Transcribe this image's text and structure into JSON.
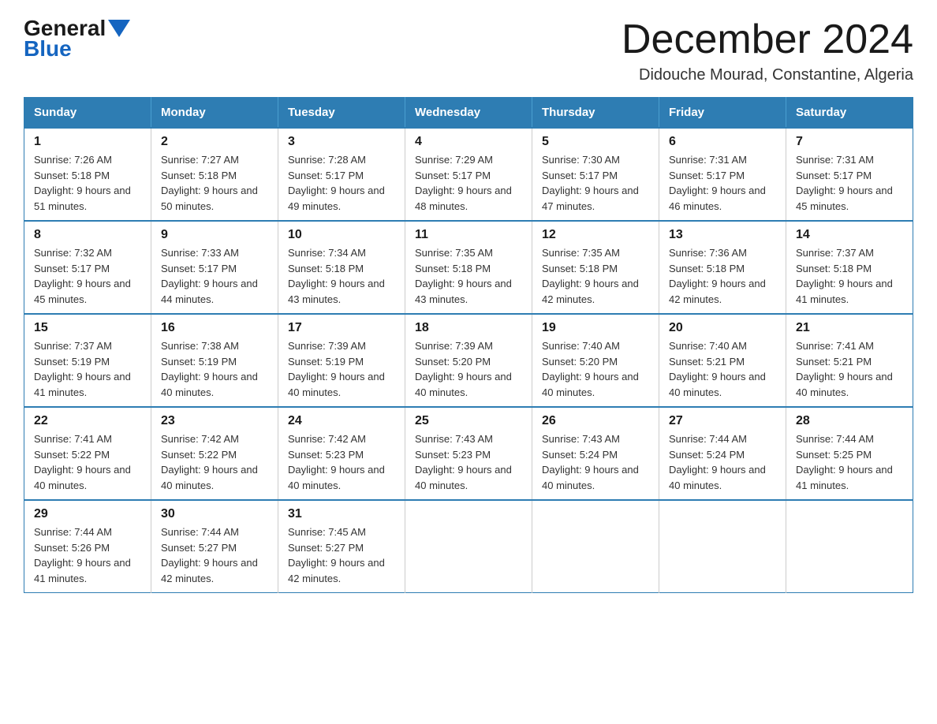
{
  "logo": {
    "general_text": "General",
    "blue_text": "Blue"
  },
  "header": {
    "month_year": "December 2024",
    "location": "Didouche Mourad, Constantine, Algeria"
  },
  "weekdays": [
    "Sunday",
    "Monday",
    "Tuesday",
    "Wednesday",
    "Thursday",
    "Friday",
    "Saturday"
  ],
  "weeks": [
    [
      {
        "day": "1",
        "sunrise": "7:26 AM",
        "sunset": "5:18 PM",
        "daylight": "9 hours and 51 minutes."
      },
      {
        "day": "2",
        "sunrise": "7:27 AM",
        "sunset": "5:18 PM",
        "daylight": "9 hours and 50 minutes."
      },
      {
        "day": "3",
        "sunrise": "7:28 AM",
        "sunset": "5:17 PM",
        "daylight": "9 hours and 49 minutes."
      },
      {
        "day": "4",
        "sunrise": "7:29 AM",
        "sunset": "5:17 PM",
        "daylight": "9 hours and 48 minutes."
      },
      {
        "day": "5",
        "sunrise": "7:30 AM",
        "sunset": "5:17 PM",
        "daylight": "9 hours and 47 minutes."
      },
      {
        "day": "6",
        "sunrise": "7:31 AM",
        "sunset": "5:17 PM",
        "daylight": "9 hours and 46 minutes."
      },
      {
        "day": "7",
        "sunrise": "7:31 AM",
        "sunset": "5:17 PM",
        "daylight": "9 hours and 45 minutes."
      }
    ],
    [
      {
        "day": "8",
        "sunrise": "7:32 AM",
        "sunset": "5:17 PM",
        "daylight": "9 hours and 45 minutes."
      },
      {
        "day": "9",
        "sunrise": "7:33 AM",
        "sunset": "5:17 PM",
        "daylight": "9 hours and 44 minutes."
      },
      {
        "day": "10",
        "sunrise": "7:34 AM",
        "sunset": "5:18 PM",
        "daylight": "9 hours and 43 minutes."
      },
      {
        "day": "11",
        "sunrise": "7:35 AM",
        "sunset": "5:18 PM",
        "daylight": "9 hours and 43 minutes."
      },
      {
        "day": "12",
        "sunrise": "7:35 AM",
        "sunset": "5:18 PM",
        "daylight": "9 hours and 42 minutes."
      },
      {
        "day": "13",
        "sunrise": "7:36 AM",
        "sunset": "5:18 PM",
        "daylight": "9 hours and 42 minutes."
      },
      {
        "day": "14",
        "sunrise": "7:37 AM",
        "sunset": "5:18 PM",
        "daylight": "9 hours and 41 minutes."
      }
    ],
    [
      {
        "day": "15",
        "sunrise": "7:37 AM",
        "sunset": "5:19 PM",
        "daylight": "9 hours and 41 minutes."
      },
      {
        "day": "16",
        "sunrise": "7:38 AM",
        "sunset": "5:19 PM",
        "daylight": "9 hours and 40 minutes."
      },
      {
        "day": "17",
        "sunrise": "7:39 AM",
        "sunset": "5:19 PM",
        "daylight": "9 hours and 40 minutes."
      },
      {
        "day": "18",
        "sunrise": "7:39 AM",
        "sunset": "5:20 PM",
        "daylight": "9 hours and 40 minutes."
      },
      {
        "day": "19",
        "sunrise": "7:40 AM",
        "sunset": "5:20 PM",
        "daylight": "9 hours and 40 minutes."
      },
      {
        "day": "20",
        "sunrise": "7:40 AM",
        "sunset": "5:21 PM",
        "daylight": "9 hours and 40 minutes."
      },
      {
        "day": "21",
        "sunrise": "7:41 AM",
        "sunset": "5:21 PM",
        "daylight": "9 hours and 40 minutes."
      }
    ],
    [
      {
        "day": "22",
        "sunrise": "7:41 AM",
        "sunset": "5:22 PM",
        "daylight": "9 hours and 40 minutes."
      },
      {
        "day": "23",
        "sunrise": "7:42 AM",
        "sunset": "5:22 PM",
        "daylight": "9 hours and 40 minutes."
      },
      {
        "day": "24",
        "sunrise": "7:42 AM",
        "sunset": "5:23 PM",
        "daylight": "9 hours and 40 minutes."
      },
      {
        "day": "25",
        "sunrise": "7:43 AM",
        "sunset": "5:23 PM",
        "daylight": "9 hours and 40 minutes."
      },
      {
        "day": "26",
        "sunrise": "7:43 AM",
        "sunset": "5:24 PM",
        "daylight": "9 hours and 40 minutes."
      },
      {
        "day": "27",
        "sunrise": "7:44 AM",
        "sunset": "5:24 PM",
        "daylight": "9 hours and 40 minutes."
      },
      {
        "day": "28",
        "sunrise": "7:44 AM",
        "sunset": "5:25 PM",
        "daylight": "9 hours and 41 minutes."
      }
    ],
    [
      {
        "day": "29",
        "sunrise": "7:44 AM",
        "sunset": "5:26 PM",
        "daylight": "9 hours and 41 minutes."
      },
      {
        "day": "30",
        "sunrise": "7:44 AM",
        "sunset": "5:27 PM",
        "daylight": "9 hours and 42 minutes."
      },
      {
        "day": "31",
        "sunrise": "7:45 AM",
        "sunset": "5:27 PM",
        "daylight": "9 hours and 42 minutes."
      },
      null,
      null,
      null,
      null
    ]
  ]
}
